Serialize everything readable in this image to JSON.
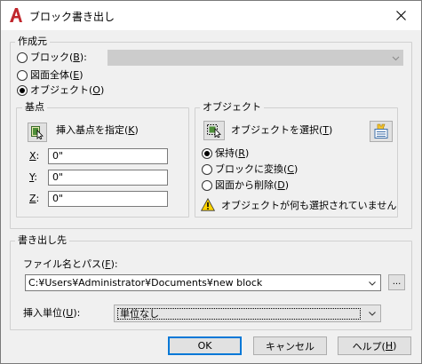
{
  "window": {
    "title": "ブロック書き出し",
    "icon": "autocad-a-icon",
    "accent_color": "#c1272d"
  },
  "source": {
    "label": "作成元",
    "options": [
      {
        "label": "ブロック(",
        "key": "B",
        "suffix": "):",
        "checked": false
      },
      {
        "label": "図面全体(",
        "key": "E",
        "suffix": ")",
        "checked": false
      },
      {
        "label": "オブジェクト(",
        "key": "O",
        "suffix": ")",
        "checked": true
      }
    ]
  },
  "base_point": {
    "label": "基点",
    "pick_label": "挿入基点を指定(",
    "pick_key": "K",
    "pick_suffix": ")",
    "x_label": "X",
    "x_suffix": ":",
    "x_value": "0\"",
    "y_label": "Y",
    "y_suffix": ":",
    "y_value": "0\"",
    "z_label": "Z",
    "z_suffix": ":",
    "z_value": "0\""
  },
  "objects": {
    "label": "オブジェクト",
    "select_label": "オブジェクトを選択(",
    "select_key": "T",
    "select_suffix": ")",
    "options": [
      {
        "label": "保持(",
        "key": "R",
        "suffix": ")",
        "checked": true
      },
      {
        "label": "ブロックに変換(",
        "key": "C",
        "suffix": ")",
        "checked": false
      },
      {
        "label": "図面から削除(",
        "key": "D",
        "suffix": ")",
        "checked": false
      }
    ],
    "warning": "オブジェクトが何も選択されていません"
  },
  "destination": {
    "label": "書き出し先",
    "path_label": "ファイル名とパス(",
    "path_key": "F",
    "path_suffix": "):",
    "path_value": "C:¥Users¥Administrator¥Documents¥new block",
    "browse_label": "...",
    "units_label": "挿入単位(",
    "units_key": "U",
    "units_suffix": "):",
    "units_value": "単位なし"
  },
  "buttons": {
    "ok": "OK",
    "cancel": "キャンセル",
    "help_prefix": "ヘルプ(",
    "help_key": "H",
    "help_suffix": ")"
  }
}
